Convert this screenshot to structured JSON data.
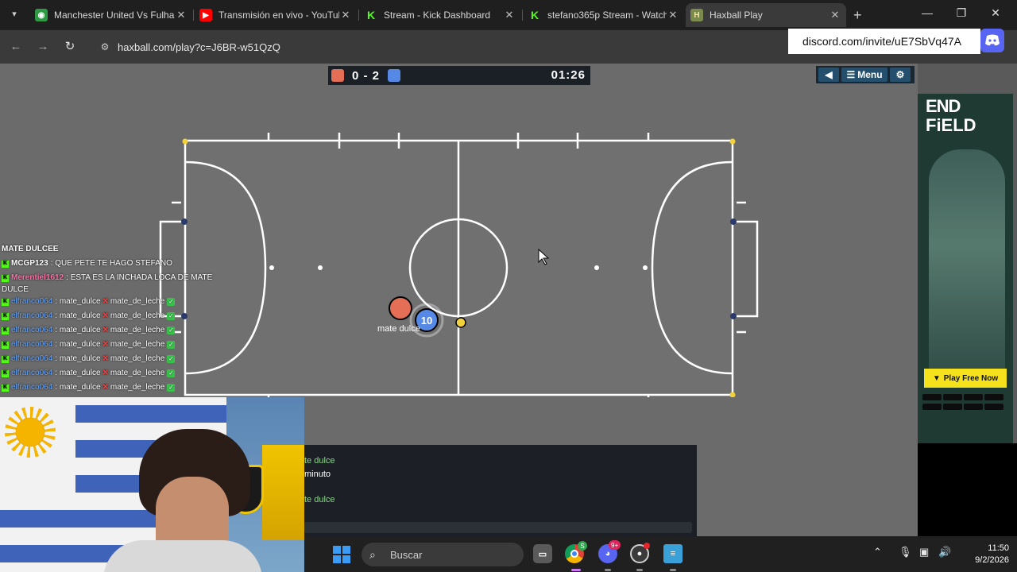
{
  "browser": {
    "tabs": [
      {
        "title": "Manchester United Vs Fulham",
        "favicon": "globe-icon",
        "color": "#2e9a44"
      },
      {
        "title": "Transmisión en vivo - YouTube",
        "favicon": "youtube-icon",
        "color": "#ff0000"
      },
      {
        "title": "Stream - Kick Dashboard",
        "favicon": "kick-icon",
        "color": "#53fc18"
      },
      {
        "title": "stefano365p Stream - Watch",
        "favicon": "kick-icon",
        "color": "#53fc18"
      },
      {
        "title": "Haxball Play",
        "favicon": "haxball-icon",
        "color": "#7a8b4d"
      }
    ],
    "active_tab": 4,
    "url": "haxball.com/play?c=J6BR-w51QzQ"
  },
  "overlay": {
    "discord_invite": "discord.com/invite/uE7SbVq47A"
  },
  "game": {
    "score_red": 0,
    "score_blue": 2,
    "score_text": "0 - 2",
    "timer": "01:26",
    "menu_label": "Menu",
    "red_color": "#e56e56",
    "blue_color": "#5689e5",
    "player_number": "10",
    "player_name": "mate dulce"
  },
  "stream_chat": {
    "header": "MATE DULCEE",
    "messages": [
      {
        "user": "MCGP123",
        "user_color": "#ffffff",
        "text": ": QUE PETE TE HAGO STEFANO",
        "badge": "kick"
      },
      {
        "user": "Merentiel1612",
        "user_color": "#ff6fa8",
        "text": ": ESTA ES LA INCHADA LOCA DE MATE",
        "badge": "kick"
      },
      {
        "user": "",
        "user_color": "#ffffff",
        "text": "DULCE",
        "badge": ""
      },
      {
        "user": "elfranco064",
        "user_color": "#63a5ff",
        "text": ": mate_dulce",
        "vs": "mate_de_leche",
        "badge": "kick"
      },
      {
        "user": "elfranco064",
        "user_color": "#63a5ff",
        "text": ": mate_dulce",
        "vs": "mate_de_leche",
        "badge": "kick"
      },
      {
        "user": "elfranco064",
        "user_color": "#63a5ff",
        "text": ": mate_dulce",
        "vs": "mate_de_leche",
        "badge": "kick"
      },
      {
        "user": "elfranco064",
        "user_color": "#63a5ff",
        "text": ": mate_dulce",
        "vs": "mate_de_leche",
        "badge": "kick"
      },
      {
        "user": "elfranco064",
        "user_color": "#63a5ff",
        "text": ": mate_dulce",
        "vs": "mate_de_leche",
        "badge": "kick"
      },
      {
        "user": "elfranco064",
        "user_color": "#63a5ff",
        "text": ": mate_dulce",
        "vs": "mate_de_leche",
        "badge": "kick"
      },
      {
        "user": "elfranco064",
        "user_color": "#63a5ff",
        "text": ": mate_dulce",
        "vs": "mate_de_leche",
        "badge": "kick"
      }
    ]
  },
  "game_chat": {
    "lines": [
      {
        "text": "te dulce",
        "color": "#8fd18f"
      },
      {
        "text": "minuto",
        "color": "#ffffff"
      },
      {
        "text": "te dulce",
        "color": "#8fd18f"
      }
    ]
  },
  "ad": {
    "title_line1": "END",
    "title_line2": "FiELD",
    "cta": "Play Free Now"
  },
  "taskbar": {
    "search_label": "Buscar",
    "chrome_badge": "S",
    "discord_badge": "9+",
    "time": "11:50",
    "date": "9/2/2026"
  }
}
